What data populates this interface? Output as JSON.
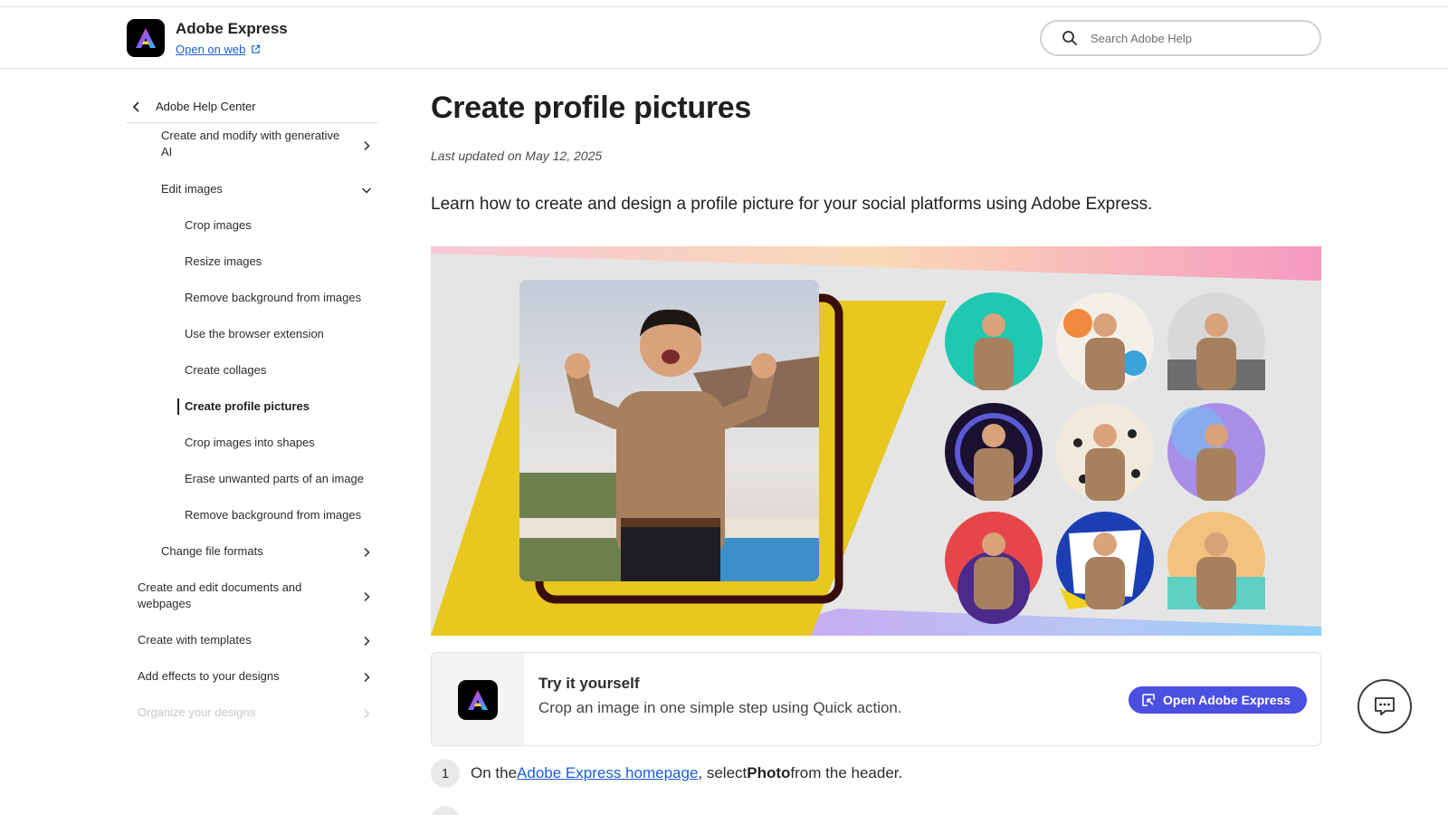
{
  "header": {
    "app_title": "Adobe Express",
    "open_on_web": "Open on web",
    "search_placeholder": "Search Adobe Help"
  },
  "sidebar": {
    "back_label": "Adobe Help Center",
    "items": [
      {
        "label_line1": "Create and modify with generative",
        "label_line2": "AI",
        "chevron": "right"
      },
      {
        "label": "Edit images",
        "chevron": "down"
      },
      {
        "label": "Crop images"
      },
      {
        "label": "Resize images"
      },
      {
        "label": "Remove background from images"
      },
      {
        "label": "Use the browser extension"
      },
      {
        "label": "Create collages"
      },
      {
        "label": "Create profile pictures",
        "active": true
      },
      {
        "label": "Crop images into shapes"
      },
      {
        "label": "Erase unwanted parts of an image"
      },
      {
        "label": "Remove background from images"
      },
      {
        "label": "Change file formats",
        "chevron": "right"
      },
      {
        "label_line1": "Create and edit documents and",
        "label_line2": "webpages",
        "chevron": "right"
      },
      {
        "label": "Create with templates",
        "chevron": "right"
      },
      {
        "label": "Add effects to your designs",
        "chevron": "right"
      },
      {
        "label": "Organize your designs",
        "chevron": "right"
      }
    ]
  },
  "main": {
    "title": "Create profile pictures",
    "last_updated": "Last updated on May 12, 2025",
    "intro": "Learn how to create and design a profile picture for your social platforms using Adobe Express.",
    "try_card": {
      "title": "Try it yourself",
      "description": "Crop an image in one simple step using Quick action.",
      "button_label": "Open Adobe Express"
    },
    "steps": [
      {
        "number": "1",
        "prefix": "On the ",
        "link": "Adobe Express homepage",
        "middle": ", select ",
        "bold": "Photo",
        "suffix": " from the header."
      }
    ]
  },
  "icons": {
    "search": "search-icon",
    "external": "external-link-icon",
    "back": "chevron-left-icon",
    "chat": "chat-icon",
    "open": "open-app-icon"
  },
  "colors": {
    "link": "#1a5ed6",
    "button": "#4a4fe0",
    "hero_yellow": "#e8c71e"
  }
}
